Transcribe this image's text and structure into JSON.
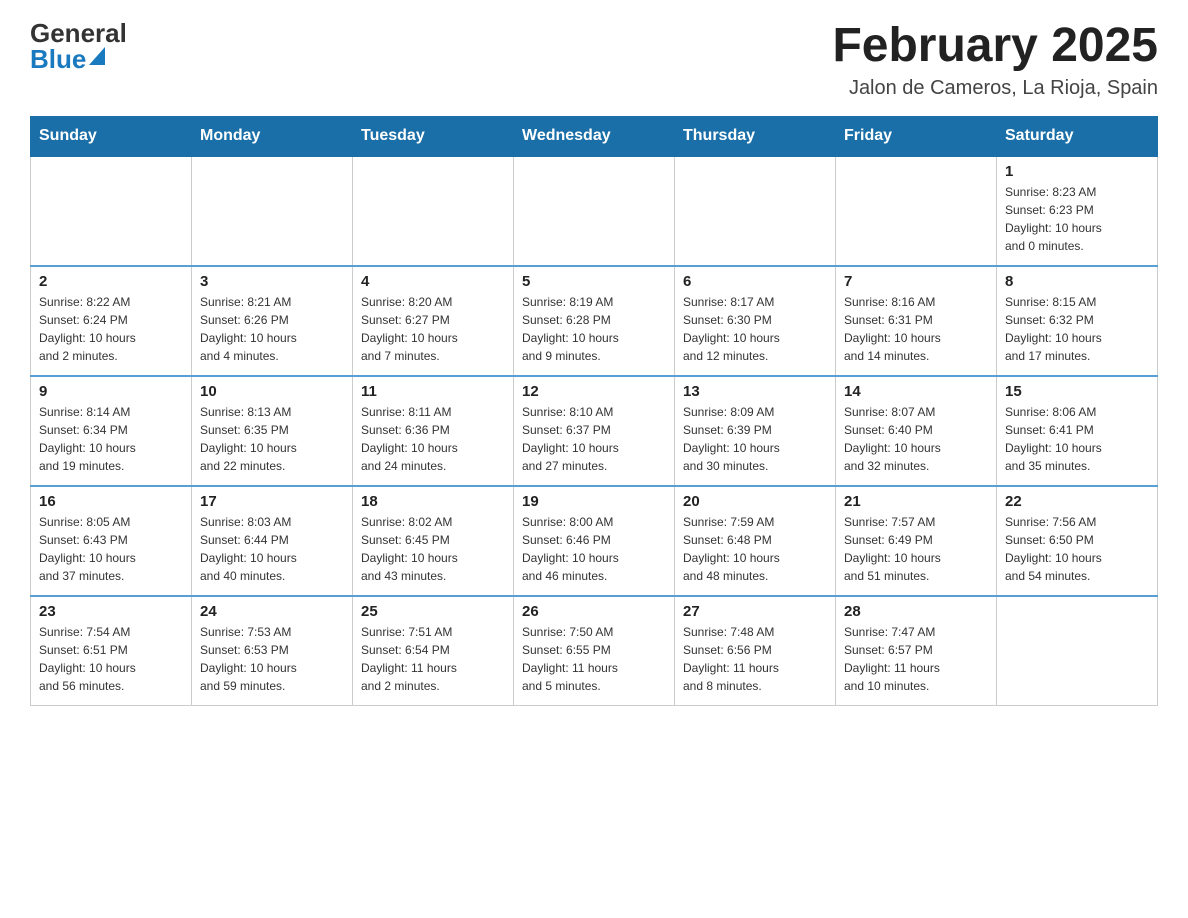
{
  "header": {
    "logo_general": "General",
    "logo_blue": "Blue",
    "month_title": "February 2025",
    "location": "Jalon de Cameros, La Rioja, Spain"
  },
  "weekdays": [
    "Sunday",
    "Monday",
    "Tuesday",
    "Wednesday",
    "Thursday",
    "Friday",
    "Saturday"
  ],
  "weeks": [
    [
      {
        "day": "",
        "info": ""
      },
      {
        "day": "",
        "info": ""
      },
      {
        "day": "",
        "info": ""
      },
      {
        "day": "",
        "info": ""
      },
      {
        "day": "",
        "info": ""
      },
      {
        "day": "",
        "info": ""
      },
      {
        "day": "1",
        "info": "Sunrise: 8:23 AM\nSunset: 6:23 PM\nDaylight: 10 hours\nand 0 minutes."
      }
    ],
    [
      {
        "day": "2",
        "info": "Sunrise: 8:22 AM\nSunset: 6:24 PM\nDaylight: 10 hours\nand 2 minutes."
      },
      {
        "day": "3",
        "info": "Sunrise: 8:21 AM\nSunset: 6:26 PM\nDaylight: 10 hours\nand 4 minutes."
      },
      {
        "day": "4",
        "info": "Sunrise: 8:20 AM\nSunset: 6:27 PM\nDaylight: 10 hours\nand 7 minutes."
      },
      {
        "day": "5",
        "info": "Sunrise: 8:19 AM\nSunset: 6:28 PM\nDaylight: 10 hours\nand 9 minutes."
      },
      {
        "day": "6",
        "info": "Sunrise: 8:17 AM\nSunset: 6:30 PM\nDaylight: 10 hours\nand 12 minutes."
      },
      {
        "day": "7",
        "info": "Sunrise: 8:16 AM\nSunset: 6:31 PM\nDaylight: 10 hours\nand 14 minutes."
      },
      {
        "day": "8",
        "info": "Sunrise: 8:15 AM\nSunset: 6:32 PM\nDaylight: 10 hours\nand 17 minutes."
      }
    ],
    [
      {
        "day": "9",
        "info": "Sunrise: 8:14 AM\nSunset: 6:34 PM\nDaylight: 10 hours\nand 19 minutes."
      },
      {
        "day": "10",
        "info": "Sunrise: 8:13 AM\nSunset: 6:35 PM\nDaylight: 10 hours\nand 22 minutes."
      },
      {
        "day": "11",
        "info": "Sunrise: 8:11 AM\nSunset: 6:36 PM\nDaylight: 10 hours\nand 24 minutes."
      },
      {
        "day": "12",
        "info": "Sunrise: 8:10 AM\nSunset: 6:37 PM\nDaylight: 10 hours\nand 27 minutes."
      },
      {
        "day": "13",
        "info": "Sunrise: 8:09 AM\nSunset: 6:39 PM\nDaylight: 10 hours\nand 30 minutes."
      },
      {
        "day": "14",
        "info": "Sunrise: 8:07 AM\nSunset: 6:40 PM\nDaylight: 10 hours\nand 32 minutes."
      },
      {
        "day": "15",
        "info": "Sunrise: 8:06 AM\nSunset: 6:41 PM\nDaylight: 10 hours\nand 35 minutes."
      }
    ],
    [
      {
        "day": "16",
        "info": "Sunrise: 8:05 AM\nSunset: 6:43 PM\nDaylight: 10 hours\nand 37 minutes."
      },
      {
        "day": "17",
        "info": "Sunrise: 8:03 AM\nSunset: 6:44 PM\nDaylight: 10 hours\nand 40 minutes."
      },
      {
        "day": "18",
        "info": "Sunrise: 8:02 AM\nSunset: 6:45 PM\nDaylight: 10 hours\nand 43 minutes."
      },
      {
        "day": "19",
        "info": "Sunrise: 8:00 AM\nSunset: 6:46 PM\nDaylight: 10 hours\nand 46 minutes."
      },
      {
        "day": "20",
        "info": "Sunrise: 7:59 AM\nSunset: 6:48 PM\nDaylight: 10 hours\nand 48 minutes."
      },
      {
        "day": "21",
        "info": "Sunrise: 7:57 AM\nSunset: 6:49 PM\nDaylight: 10 hours\nand 51 minutes."
      },
      {
        "day": "22",
        "info": "Sunrise: 7:56 AM\nSunset: 6:50 PM\nDaylight: 10 hours\nand 54 minutes."
      }
    ],
    [
      {
        "day": "23",
        "info": "Sunrise: 7:54 AM\nSunset: 6:51 PM\nDaylight: 10 hours\nand 56 minutes."
      },
      {
        "day": "24",
        "info": "Sunrise: 7:53 AM\nSunset: 6:53 PM\nDaylight: 10 hours\nand 59 minutes."
      },
      {
        "day": "25",
        "info": "Sunrise: 7:51 AM\nSunset: 6:54 PM\nDaylight: 11 hours\nand 2 minutes."
      },
      {
        "day": "26",
        "info": "Sunrise: 7:50 AM\nSunset: 6:55 PM\nDaylight: 11 hours\nand 5 minutes."
      },
      {
        "day": "27",
        "info": "Sunrise: 7:48 AM\nSunset: 6:56 PM\nDaylight: 11 hours\nand 8 minutes."
      },
      {
        "day": "28",
        "info": "Sunrise: 7:47 AM\nSunset: 6:57 PM\nDaylight: 11 hours\nand 10 minutes."
      },
      {
        "day": "",
        "info": ""
      }
    ]
  ]
}
